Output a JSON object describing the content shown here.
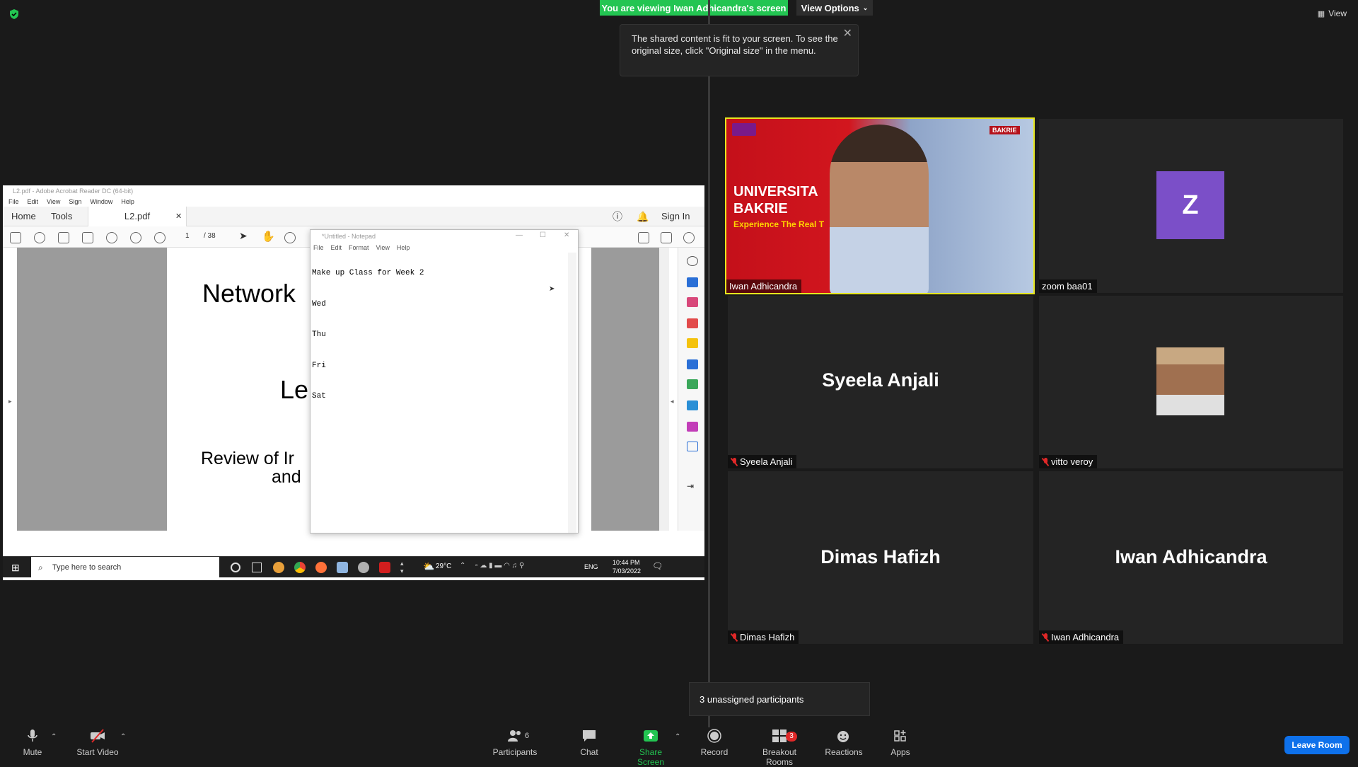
{
  "banner": {
    "viewing": "You are viewing Iwan Adhicandra's screen",
    "view_options": "View Options"
  },
  "tooltip": {
    "text": "The shared content is fit to your screen. To see the original size, click \"Original size\" in the menu."
  },
  "top_right": {
    "view": "View"
  },
  "acrobat": {
    "title": "L2.pdf - Adobe Acrobat Reader DC (64-bit)",
    "menu": [
      "File",
      "Edit",
      "View",
      "Sign",
      "Window",
      "Help"
    ],
    "tabs": {
      "home": "Home",
      "tools": "Tools",
      "doc": "L2.pdf"
    },
    "sign_in": "Sign In",
    "page_num": "1",
    "page_total": "/ 38",
    "pdf_lines": {
      "l1": "Network",
      "l2": "Le",
      "l3": "Review of Ir",
      "l4": "and"
    }
  },
  "notepad": {
    "title": "*Untitled - Notepad",
    "menu": [
      "File",
      "Edit",
      "Format",
      "View",
      "Help"
    ],
    "text": "Make up Class for Week 2\nWed\nThu\nFri\nSat"
  },
  "taskbar": {
    "search": "Type here to search",
    "temp": "29°C",
    "lang": "ENG",
    "time": "10:44 PM",
    "date": "7/03/2022"
  },
  "tiles": {
    "video": {
      "name": "Iwan Adhicandra",
      "banner_l1": "UNIVERSITA",
      "banner_l2": "BAKRIE",
      "banner_l3": "Experience The Real T",
      "logo": "BAKRIE"
    },
    "zoom": {
      "name": "zoom baa01",
      "avatar_letter": "Z"
    },
    "syeela": {
      "big": "Syeela Anjali",
      "name": "Syeela Anjali"
    },
    "vitto": {
      "name": "vitto veroy"
    },
    "dimas": {
      "big": "Dimas Hafizh",
      "name": "Dimas Hafizh"
    },
    "iwan": {
      "big": "Iwan Adhicandra",
      "name": "Iwan Adhicandra"
    }
  },
  "unassigned": "3 unassigned participants",
  "toolbar": {
    "mute": "Mute",
    "start_video": "Start Video",
    "participants": "Participants",
    "participants_count": "6",
    "chat": "Chat",
    "share_screen": "Share Screen",
    "record": "Record",
    "breakout": "Breakout Rooms",
    "breakout_badge": "3",
    "reactions": "Reactions",
    "apps": "Apps",
    "leave": "Leave Room"
  },
  "colors": {
    "accent_green": "#23c552",
    "leave_blue": "#0e71eb",
    "speaker_border": "#e6e61e",
    "mic_red": "#e02828",
    "avatar_purple": "#7b4fc8"
  }
}
